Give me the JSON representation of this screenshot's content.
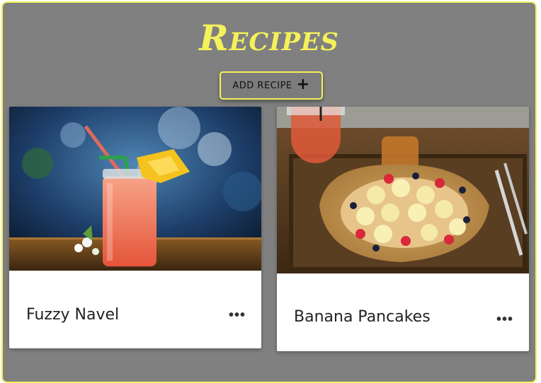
{
  "page": {
    "title": "Recipes"
  },
  "toolbar": {
    "add_label": "ADD RECIPE",
    "add_icon": "plus-icon"
  },
  "colors": {
    "accent": "#f4f25a",
    "background": "#808080",
    "card": "#ffffff"
  },
  "recipes": [
    {
      "name": "Fuzzy Navel",
      "menu_icon": "more-horizontal-icon",
      "menu_glyph": "•••"
    },
    {
      "name": "Banana Pancakes",
      "menu_icon": "more-horizontal-icon",
      "menu_glyph": "•••"
    }
  ]
}
